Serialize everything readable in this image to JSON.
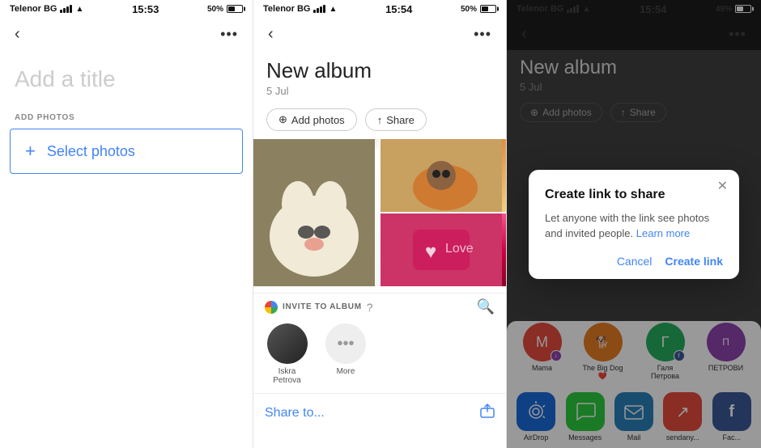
{
  "panel1": {
    "status": {
      "carrier": "Telenor BG",
      "time": "15:53",
      "battery": "50%",
      "batteryWidth": "50%"
    },
    "nav": {
      "back": "‹",
      "menu": "•••"
    },
    "title": "Add a title",
    "addPhotosLabel": "ADD PHOTOS",
    "selectPhotos": {
      "plus": "+",
      "label": "Select photos"
    }
  },
  "panel2": {
    "status": {
      "carrier": "Telenor BG",
      "time": "15:54",
      "battery": "50%",
      "batteryWidth": "50%"
    },
    "nav": {
      "back": "‹",
      "menu": "•••"
    },
    "albumTitle": "New album",
    "albumDate": "5 Jul",
    "actions": {
      "addPhotos": "Add photos",
      "share": "Share"
    },
    "inviteSection": {
      "label": "INVITE TO ALBUM",
      "avatars": [
        {
          "name": "Iskra Petrova",
          "type": "photo"
        },
        {
          "name": "More",
          "type": "more"
        }
      ]
    },
    "shareTo": "Share to..."
  },
  "panel3": {
    "status": {
      "carrier": "Telenor BG",
      "time": "15:54",
      "battery": "49%",
      "batteryWidth": "49%"
    },
    "nav": {
      "back": "‹",
      "menu": "•••"
    },
    "albumTitle": "New album",
    "albumDate": "5 Jul",
    "actions": {
      "addPhotos": "Add photos",
      "share": "Share"
    },
    "contacts": [
      {
        "name": "Mama",
        "color": "#e74c3c",
        "badge": "purple",
        "badgeIcon": "♪"
      },
      {
        "name": "The Big Dog ❤️",
        "color": "#e67e22",
        "badge": null
      },
      {
        "name": "Галя Петрова",
        "color": "#27ae60",
        "badge": "blue",
        "badgeIcon": "f"
      },
      {
        "name": "ПЕТРОВИ",
        "color": "#8e44ad",
        "badge": null
      }
    ],
    "shareApps": [
      {
        "name": "AirDrop",
        "icon": "📶",
        "class": "icon-airdrop"
      },
      {
        "name": "Messages",
        "icon": "💬",
        "class": "icon-messages"
      },
      {
        "name": "Mail",
        "icon": "✉️",
        "class": "icon-mail"
      },
      {
        "name": "sendany...",
        "icon": "↗",
        "class": "icon-sendany"
      },
      {
        "name": "Fac...",
        "icon": "f",
        "class": "icon-face"
      }
    ],
    "modal": {
      "title": "Create link to share",
      "body": "Let anyone with the link see photos and invited people.",
      "learnMore": "Learn more",
      "cancel": "Cancel",
      "create": "Create link"
    }
  }
}
